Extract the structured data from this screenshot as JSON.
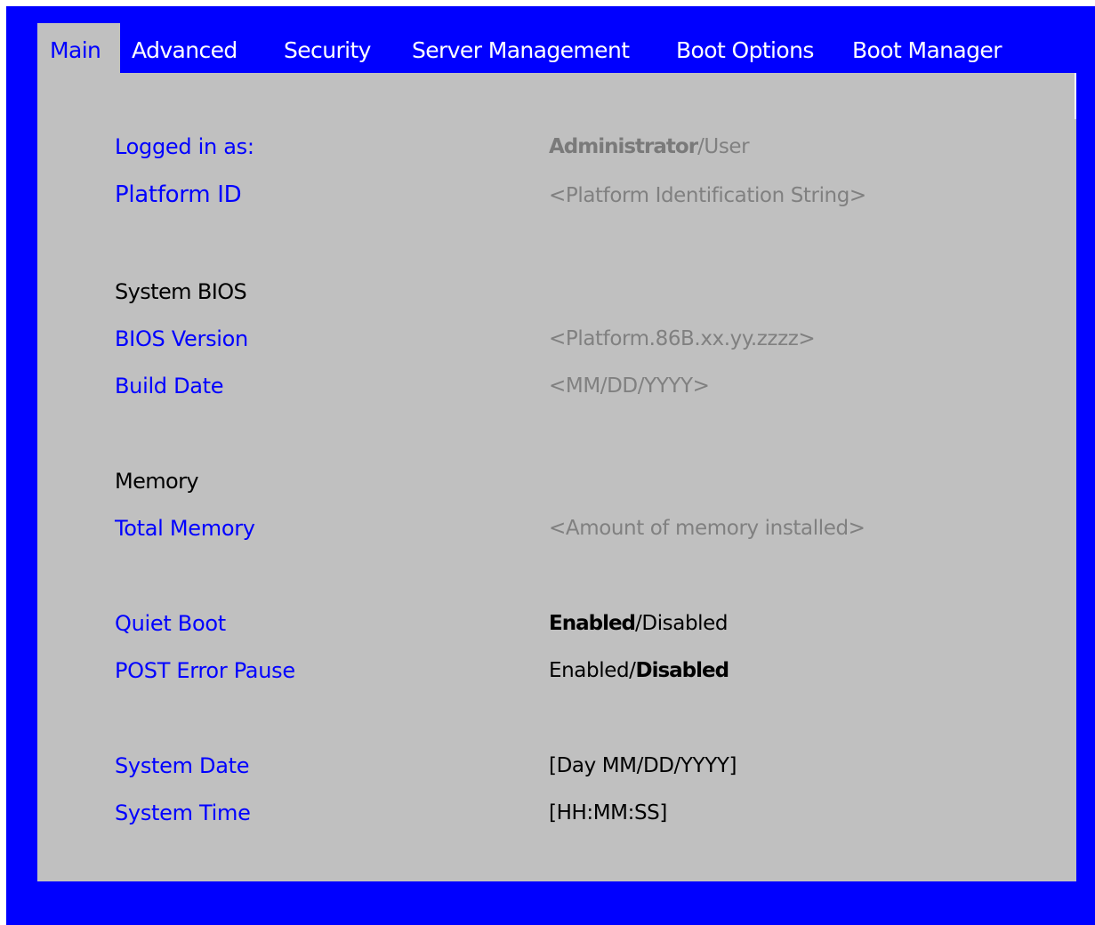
{
  "tabs": [
    {
      "label": "Main",
      "active": true
    },
    {
      "label": "Advanced",
      "active": false
    },
    {
      "label": "Security",
      "active": false
    },
    {
      "label": "Server Management",
      "active": false
    },
    {
      "label": "Boot Options",
      "active": false
    },
    {
      "label": "Boot Manager",
      "active": false
    }
  ],
  "main": {
    "logged_in_as": {
      "label": "Logged in as:",
      "value_selected": "Administrator",
      "value_rest": "/User"
    },
    "platform_id": {
      "label": "Platform ID",
      "value": "<Platform Identification String>"
    },
    "system_bios_header": "System BIOS",
    "bios_version": {
      "label": "BIOS Version",
      "value": "<Platform.86B.xx.yy.zzzz>"
    },
    "build_date": {
      "label": "Build Date",
      "value": "<MM/DD/YYYY>"
    },
    "memory_header": "Memory",
    "total_memory": {
      "label": "Total Memory",
      "value": "<Amount of memory installed>"
    },
    "quiet_boot": {
      "label": "Quiet Boot",
      "value_selected": "Enabled",
      "value_rest": "/Disabled"
    },
    "post_error_pause": {
      "label": "POST Error Pause",
      "value_rest": "Enabled/",
      "value_selected": "Disabled"
    },
    "system_date": {
      "label": "System Date",
      "value": "[Day MM/DD/YYYY]"
    },
    "system_time": {
      "label": "System Time",
      "value": "[HH:MM:SS]"
    }
  },
  "colors": {
    "frame": "#0000ff",
    "panel": "#c0c0c0",
    "label": "#0000ff",
    "info_value": "#808080",
    "editable_value": "#000000"
  }
}
